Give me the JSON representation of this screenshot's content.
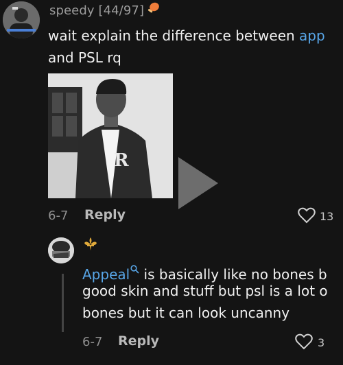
{
  "comment": {
    "username": "speedy [44/97]",
    "text_line1_prefix": "wait explain the difference between ",
    "text_line1_link": "app",
    "text_line2": "and PSL rq",
    "time": "6-7",
    "reply_label": "Reply",
    "like_count": "13",
    "avatar_icon": "avatar-icon"
  },
  "reply": {
    "username_icon": "fleur-de-lis-icon",
    "mention": "Appeal",
    "search_icon": "search-icon",
    "text_line1_suffix": " is basically like no bones b",
    "text_line2": "good skin and stuff but psl is a lot o",
    "text_line3": "bones but it can look uncanny",
    "time": "6-7",
    "reply_label": "Reply",
    "like_count": "3"
  },
  "colors": {
    "background": "#141414",
    "link": "#58a6e8",
    "muted": "#8f8f8f"
  }
}
